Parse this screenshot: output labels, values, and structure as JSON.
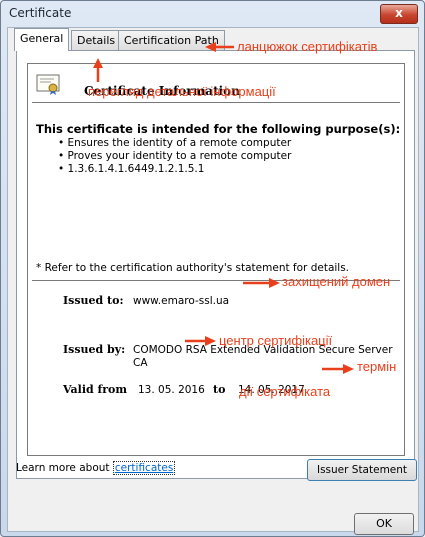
{
  "window": {
    "title": "Certificate",
    "close_label": "x"
  },
  "tabs": [
    {
      "label": "General"
    },
    {
      "label": "Details"
    },
    {
      "label": "Certification Path"
    }
  ],
  "cert": {
    "title": "Certificate Information",
    "purpose_heading": "This certificate is intended for the following purpose(s):",
    "purposes": [
      "Ensures the identity of a remote computer",
      "Proves your identity to a remote computer",
      "1.3.6.1.4.1.6449.1.2.1.5.1"
    ],
    "refer_note": "* Refer to the certification authority's statement for details.",
    "issued_to_label": "Issued to:",
    "issued_to_value": "www.emaro-ssl.ua",
    "issued_by_label": "Issued by:",
    "issued_by_value_line1": "COMODO RSA Extended Validation Secure Server",
    "issued_by_value_line2": "CA",
    "valid_from_label": "Valid from",
    "valid_from_value": "13. 05. 2016",
    "valid_to_label": "to",
    "valid_to_value": "14. 05. 2017"
  },
  "buttons": {
    "issuer_statement": "Issuer Statement",
    "ok": "OK"
  },
  "learn_more": {
    "prefix": "Learn more about",
    "link": "certificates"
  },
  "annotations": {
    "chain": "ланцюжок сертифікатів",
    "details_view": "перегляд детальної інформації",
    "protected_domain": "захищений домен",
    "cert_center": "центр сертифікації",
    "term_line1": "термін",
    "term_line2": "дії сертифіката"
  },
  "colors": {
    "annotation": "#e8401c",
    "link": "#0066cc"
  }
}
